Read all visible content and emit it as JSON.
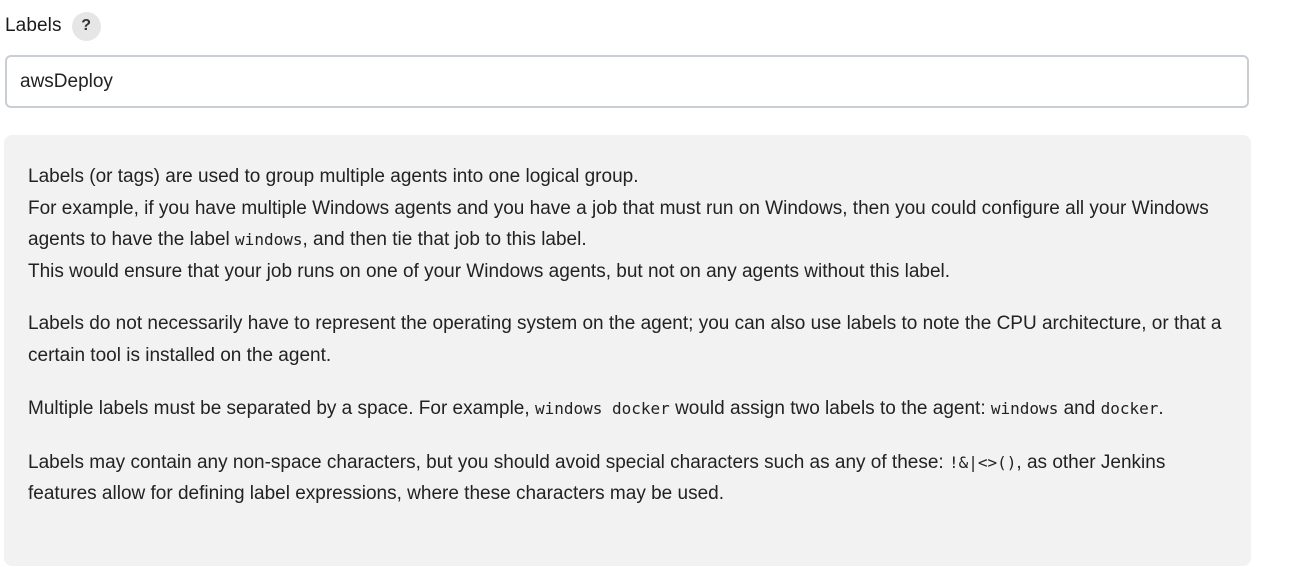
{
  "field": {
    "label": "Labels",
    "help_glyph": "?",
    "value": "awsDeploy",
    "help_icon": "question-mark-icon"
  },
  "help": {
    "p1": {
      "line1": "Labels (or tags) are used to group multiple agents into one logical group.",
      "line2a": "For example, if you have multiple Windows agents and you have a job that must run on Windows, then you could configure all your Windows agents to have the label ",
      "code1": "windows",
      "line2b": ", and then tie that job to this label.",
      "line3": "This would ensure that your job runs on one of your Windows agents, but not on any agents without this label."
    },
    "p2": "Labels do not necessarily have to represent the operating system on the agent; you can also use labels to note the CPU architecture, or that a certain tool is installed on the agent.",
    "p3": {
      "a": "Multiple labels must be separated by a space. For example, ",
      "code1": "windows docker",
      "b": " would assign two labels to the agent: ",
      "code2": "windows",
      "c": " and ",
      "code3": "docker",
      "d": "."
    },
    "p4": {
      "a": "Labels may contain any non-space characters, but you should avoid special characters such as any of these: ",
      "code1": "!&|<>()",
      "b": ", as other Jenkins features allow for defining label expressions, where these characters may be used."
    }
  },
  "colors": {
    "panel_bg": "#f2f2f2",
    "input_border": "#c9ced4",
    "help_button_bg": "#e6e6e6"
  }
}
